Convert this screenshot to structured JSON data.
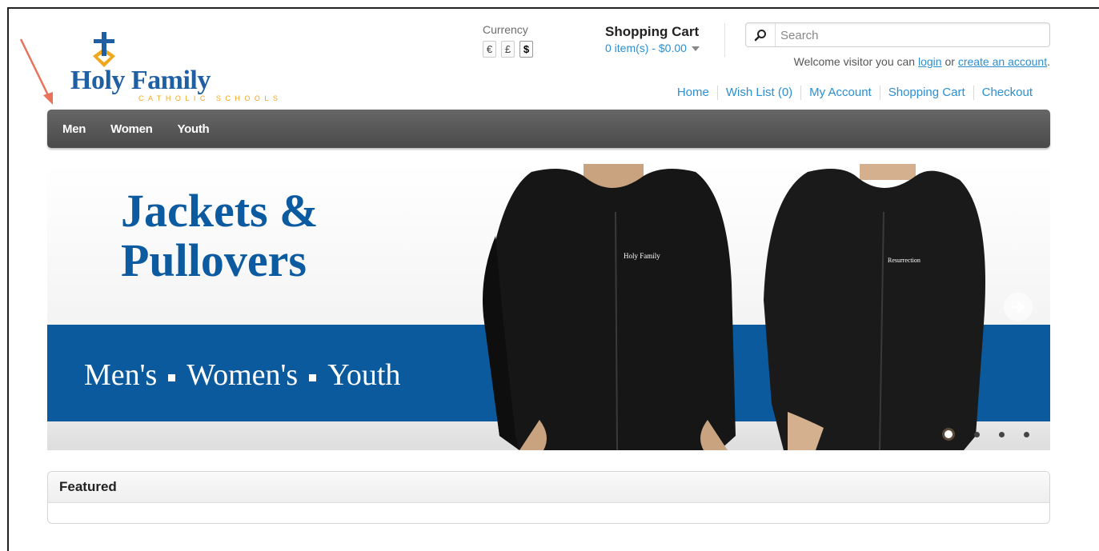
{
  "brand": {
    "name": "Holy Family",
    "subtitle": "CATHOLIC SCHOOLS",
    "colors": {
      "primary": "#1f5fa3",
      "accent": "#f0a720"
    }
  },
  "currency": {
    "title": "Currency",
    "options": [
      "€",
      "£",
      "$"
    ],
    "selected": "$"
  },
  "cart": {
    "title": "Shopping Cart",
    "summary": "0 item(s) - $0.00"
  },
  "search": {
    "placeholder": "Search",
    "icon": "search-icon"
  },
  "welcome": {
    "prefix": "Welcome visitor you can",
    "login": "login",
    "or": "or",
    "create": "create an account",
    "suffix": "."
  },
  "top_links": [
    "Home",
    "Wish List (0)",
    "My Account",
    "Shopping Cart",
    "Checkout"
  ],
  "nav": [
    "Men",
    "Women",
    "Youth"
  ],
  "banner": {
    "headline_line1": "Jackets &",
    "headline_line2": "Pullovers",
    "categories": [
      "Men's",
      "Women's",
      "Youth"
    ],
    "jacket_left_text": "Holy Family",
    "jacket_right_text": "Resurrection",
    "slides": 4,
    "active_slide": 1,
    "colors": {
      "stripe": "#0b5a9d",
      "headline": "#0c5aa0"
    }
  },
  "featured": {
    "title": "Featured"
  }
}
